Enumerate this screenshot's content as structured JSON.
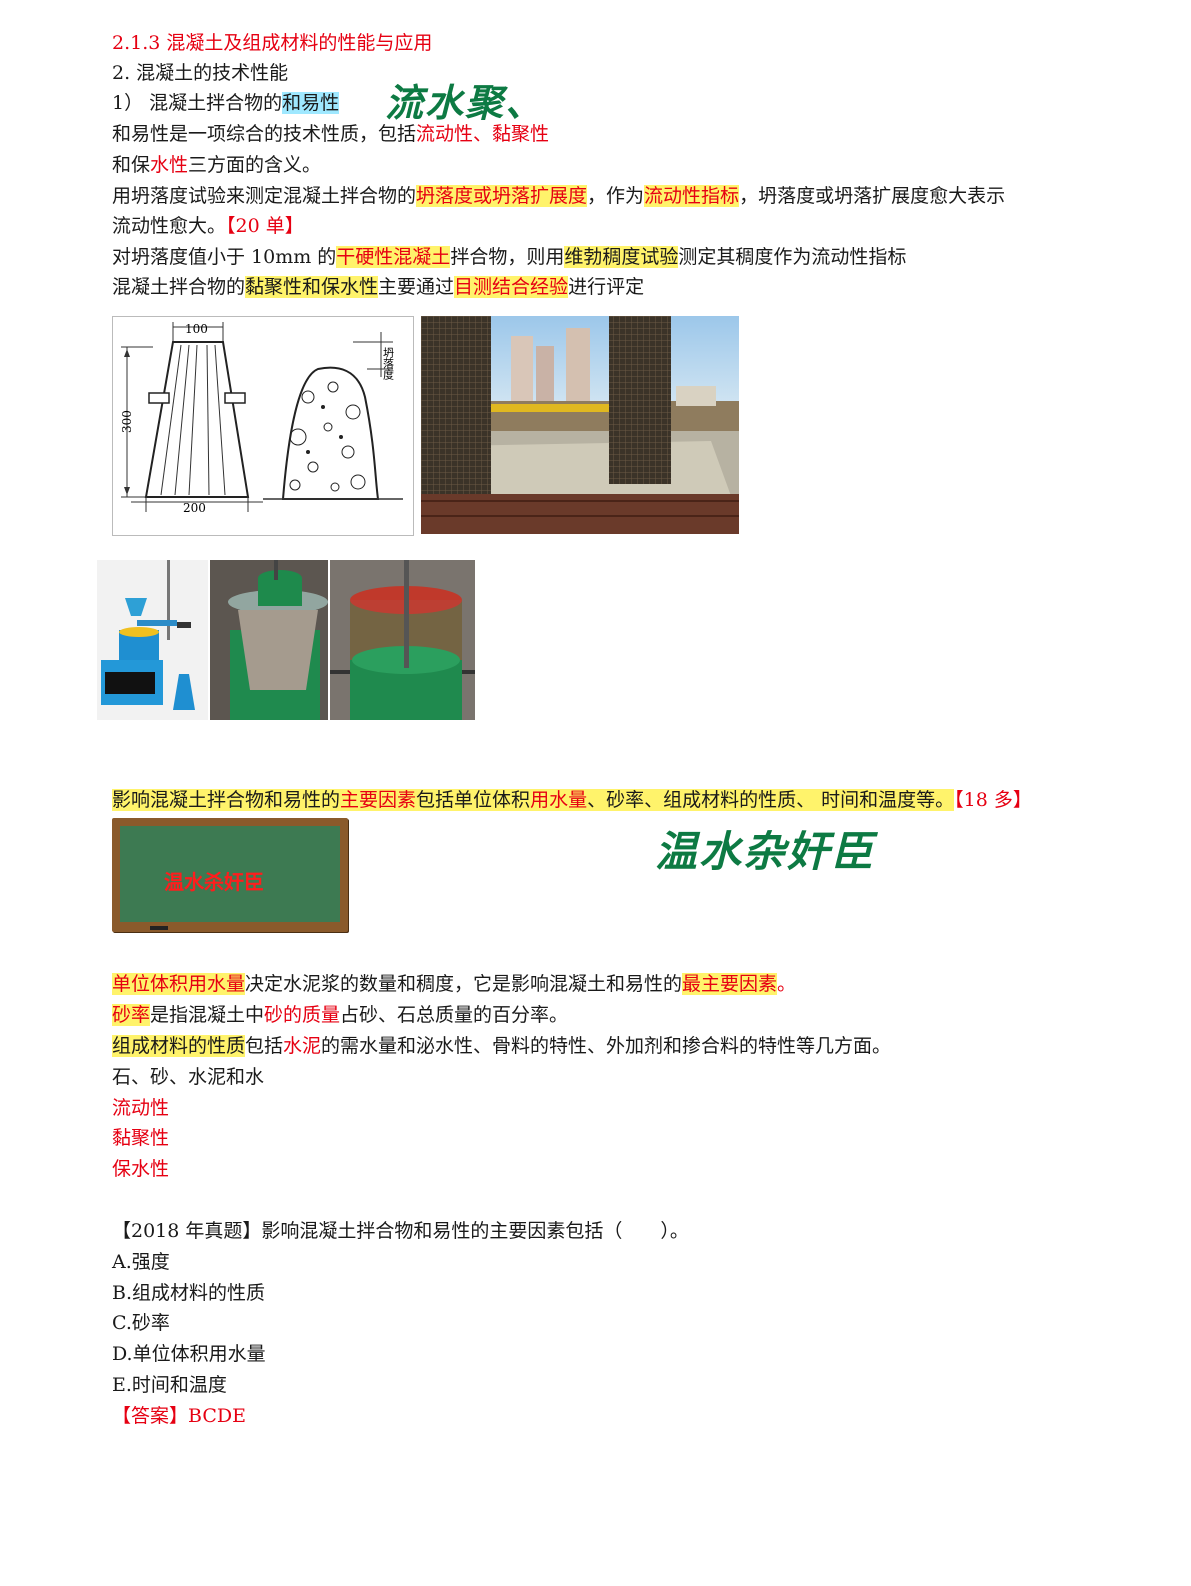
{
  "section": {
    "number": "2.1.3",
    "title": "混凝土及组成材料的性能与应用"
  },
  "subsection": "2. 混凝土的技术性能",
  "topic": {
    "num": "1）",
    "prefix": "混凝土拌合物的",
    "hl": "和易性"
  },
  "handwriting": {
    "note1": "流水聚、",
    "note2": "温水杂奸臣"
  },
  "p1": {
    "a": "和易性是一项综合的技术性质，包括",
    "b": "流动性、黏聚性"
  },
  "p2": {
    "a": "和保",
    "b": "水性",
    "c": "三方面的含义。"
  },
  "p3": {
    "a": "用坍落度试验来测定混凝土拌合物的",
    "b": "坍落度或坍落扩展度",
    "c": "，作为",
    "d": "流动性指标",
    "e": "，坍落度或坍落扩展度愈大表示"
  },
  "p4": {
    "a": "流动性愈大。",
    "b": "【20 单】"
  },
  "p5": {
    "a": "对坍落度值小于 10mm 的",
    "b": "干硬性混凝土",
    "c": "拌合物，则用",
    "d": "维勃稠度试验",
    "e": "测定其稠度作为流动性指标"
  },
  "p6": {
    "a": "混凝土拌合物的",
    "b": "黏聚性和保水性",
    "c": "主要通过",
    "d": "目测结合经验",
    "e": "进行评定"
  },
  "diagram": {
    "top_dim": "100",
    "height_dim": "300",
    "bottom_dim": "200",
    "slump_label": "坍落度"
  },
  "p7": {
    "a": "影响混凝土拌合物和易性的",
    "b": "主要因素",
    "c": "包括",
    "d": "单位体积",
    "e": "用水量",
    "f": "、砂率、组成材料的性质、 时间和温度等。",
    "g": "【18 多】"
  },
  "board": "温水杀奸臣",
  "p8": {
    "a": "单位体积用水量",
    "b": "决定水泥浆的数量和稠度，它是影响混凝土和易性的",
    "c": "最主要因素",
    "d": "。"
  },
  "p9": {
    "a": "砂率",
    "b": "是指混凝土中",
    "c": "砂的质量",
    "d": "占砂、石总质量的百分率。"
  },
  "p10": {
    "a": "组成材料的性质",
    "b": "包括",
    "c": "水泥",
    "d": "的需水量和泌水性、骨料的特性、外加剂和掺合料的特性等几方面。"
  },
  "p11": "石、砂、水泥和水",
  "list": [
    "流动性",
    "黏聚性",
    "保水性"
  ],
  "question": "【2018 年真题】影响混凝土拌合物和易性的主要因素包括（　　）。",
  "options": [
    "A.强度",
    "B.组成材料的性质",
    "C.砂率",
    "D.单位体积用水量",
    "E.时间和温度"
  ],
  "answer": {
    "label": "【答案】",
    "value": "BCDE"
  }
}
